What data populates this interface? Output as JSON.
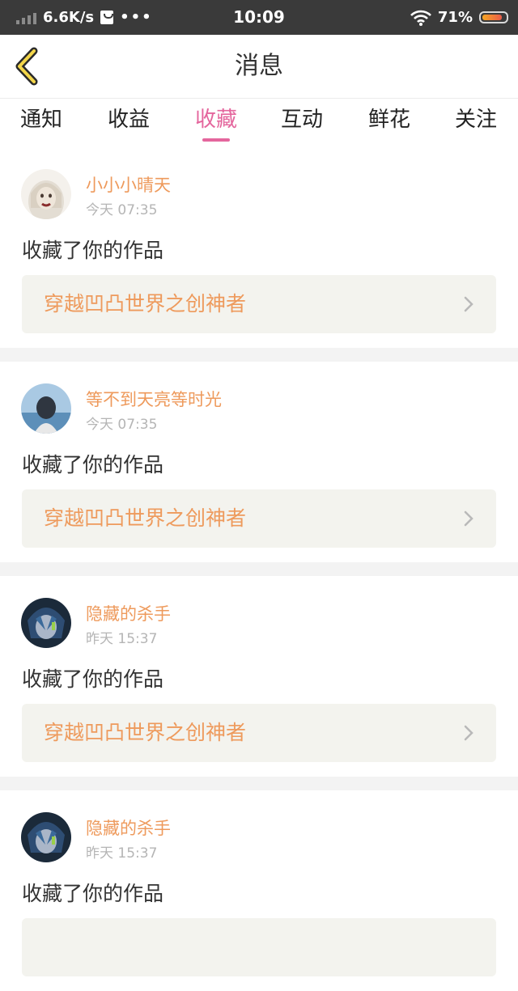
{
  "status_bar": {
    "speed": "6.6K/s",
    "more": "•••",
    "time": "10:09",
    "battery": "71%",
    "battery_level": 0.71
  },
  "header": {
    "title": "消息",
    "back_icon": "chevron-left-icon"
  },
  "tabs": [
    {
      "label": "通知",
      "active": false
    },
    {
      "label": "收益",
      "active": false
    },
    {
      "label": "收藏",
      "active": true
    },
    {
      "label": "互动",
      "active": false
    },
    {
      "label": "鲜花",
      "active": false
    },
    {
      "label": "关注",
      "active": false
    }
  ],
  "colors": {
    "accent_pink": "#e4669d",
    "accent_orange": "#ee9a5c",
    "status_bar_bg": "#3a3a3a",
    "work_box_bg": "#f3f3ee"
  },
  "messages": [
    {
      "user": "小小小晴天",
      "time": "今天 07:35",
      "text": "收藏了你的作品",
      "work": "穿越凹凸世界之创神者"
    },
    {
      "user": "等不到天亮等时光",
      "time": "今天 07:35",
      "text": "收藏了你的作品",
      "work": "穿越凹凸世界之创神者"
    },
    {
      "user": "隐藏的杀手",
      "time": "昨天 15:37",
      "text": "收藏了你的作品",
      "work": "穿越凹凸世界之创神者"
    },
    {
      "user": "隐藏的杀手",
      "time": "昨天 15:37",
      "text": "收藏了你的作品",
      "work": ""
    }
  ]
}
